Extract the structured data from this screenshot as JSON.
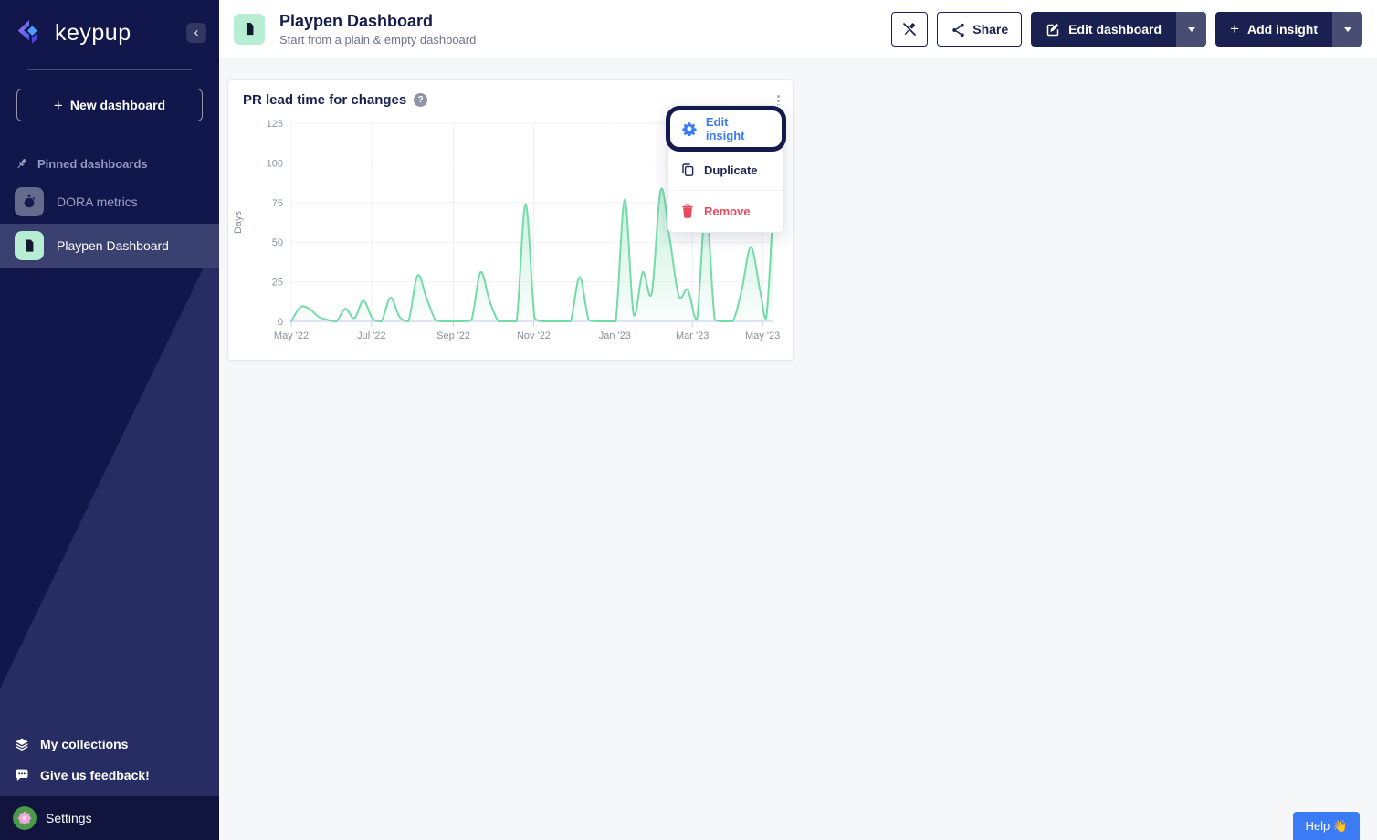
{
  "sidebar": {
    "brand": "keypup",
    "new_dashboard_button": "New dashboard",
    "pinned_section_label": "Pinned dashboards",
    "pinned_items": [
      {
        "label": "DORA metrics",
        "selected": false
      },
      {
        "label": "Playpen Dashboard",
        "selected": true
      }
    ],
    "footer_links": [
      {
        "label": "My collections"
      },
      {
        "label": "Give us feedback!"
      }
    ],
    "settings_label": "Settings"
  },
  "header": {
    "title": "Playpen Dashboard",
    "subtitle": "Start from a plain & empty dashboard",
    "share_button": "Share",
    "edit_dashboard_button": "Edit dashboard",
    "add_insight_button": "Add insight"
  },
  "insight_card": {
    "title": "PR lead time for changes"
  },
  "context_menu": {
    "items": [
      {
        "label": "Edit insight",
        "focused": true,
        "destructive": false
      },
      {
        "label": "Duplicate",
        "focused": false,
        "destructive": false
      },
      {
        "label": "Remove",
        "focused": false,
        "destructive": true
      }
    ]
  },
  "help_button_label": "Help 👋",
  "icons": {
    "plus": "+",
    "question_mark": "?",
    "collapse_chevron": "‹"
  },
  "colors": {
    "sidebar_navy": "#11164B",
    "sidebar_triangle": "#272D63",
    "selected_row": "#3A4170",
    "mint": "#B7EDD2",
    "navy": "#1A2150",
    "accent_blue": "#3B7BF6",
    "remove_red": "#E8495F",
    "chart_line": "#74DBA8",
    "content_bg": "#F6F7F9"
  },
  "chart_data": {
    "type": "area",
    "title": "PR lead time for changes",
    "xlabel": "",
    "ylabel": "Days",
    "ylim": [
      0,
      125
    ],
    "y_ticks": [
      0,
      25,
      50,
      75,
      100,
      125
    ],
    "x_tick_labels": [
      "May '22",
      "Jul '22",
      "Sep '22",
      "Nov '22",
      "Jan '23",
      "Mar '23",
      "May '23"
    ],
    "x_tick_positions": [
      0,
      8.9,
      18.0,
      26.9,
      35.9,
      44.5,
      52.3
    ],
    "x_unit": "weeks since 2022-05-01",
    "x_domain": [
      0,
      53.4
    ],
    "x": [
      0,
      1,
      2,
      3,
      4,
      5,
      6,
      7,
      8,
      9,
      10,
      11,
      12,
      13,
      14,
      15,
      16,
      17,
      18,
      19,
      20,
      21,
      22,
      23,
      24,
      25,
      26,
      27,
      28,
      29,
      30,
      31,
      32,
      33,
      34,
      35,
      36,
      37,
      38,
      39,
      40,
      41,
      42,
      43,
      44,
      45,
      46,
      47,
      48,
      49,
      50,
      51,
      52,
      52.7,
      53.4
    ],
    "values": [
      0,
      9,
      8,
      3,
      1,
      0,
      8,
      2,
      13,
      2,
      0,
      15,
      3,
      0,
      29,
      15,
      1,
      0,
      0,
      0,
      1,
      31,
      13,
      0,
      0,
      0,
      74,
      2,
      0,
      0,
      0,
      0,
      28,
      1,
      0,
      0,
      0,
      77,
      4,
      31,
      18,
      83,
      52,
      16,
      20,
      1,
      72,
      1,
      0,
      0,
      20,
      47,
      20,
      2,
      65
    ],
    "line_color": "#74DBA8",
    "fill": "mint-gradient-to-transparent",
    "grid": true,
    "legend_position": "none"
  }
}
